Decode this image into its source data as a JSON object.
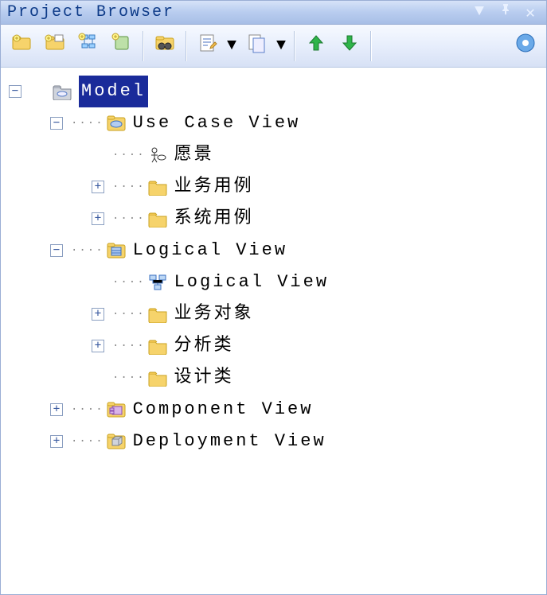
{
  "titlebar": {
    "title": "Project Browser"
  },
  "toolbar": {
    "items": [
      {
        "name": "new-model",
        "kind": "icon"
      },
      {
        "name": "new-package",
        "kind": "icon"
      },
      {
        "name": "new-diagram",
        "kind": "icon"
      },
      {
        "name": "new-element",
        "kind": "icon"
      },
      {
        "name": "sep"
      },
      {
        "name": "search",
        "kind": "icon"
      },
      {
        "name": "sep"
      },
      {
        "name": "edit",
        "kind": "dropdown"
      },
      {
        "name": "copy",
        "kind": "dropdown"
      },
      {
        "name": "sep"
      },
      {
        "name": "move-up",
        "kind": "icon"
      },
      {
        "name": "move-down",
        "kind": "icon"
      },
      {
        "name": "sep"
      },
      {
        "name": "help",
        "kind": "icon"
      }
    ]
  },
  "tree": {
    "root": {
      "label": "Model",
      "expanded": true,
      "selected": true,
      "icon": "model",
      "children": [
        {
          "label": "Use Case View",
          "expanded": true,
          "icon": "usecase-view",
          "children": [
            {
              "label": "愿景",
              "icon": "actor",
              "leaf": true
            },
            {
              "label": "业务用例",
              "icon": "folder",
              "expanded": false
            },
            {
              "label": "系统用例",
              "icon": "folder",
              "expanded": false
            }
          ]
        },
        {
          "label": "Logical View",
          "expanded": true,
          "icon": "logical-view",
          "children": [
            {
              "label": "Logical View",
              "icon": "class-diagram",
              "leaf": true
            },
            {
              "label": "业务对象",
              "icon": "folder",
              "expanded": false
            },
            {
              "label": "分析类",
              "icon": "folder",
              "expanded": false
            },
            {
              "label": "设计类",
              "icon": "folder",
              "leaf": true
            }
          ]
        },
        {
          "label": "Component View",
          "icon": "component-view",
          "expanded": false
        },
        {
          "label": "Deployment View",
          "icon": "deployment-view",
          "expanded": false
        }
      ]
    }
  }
}
